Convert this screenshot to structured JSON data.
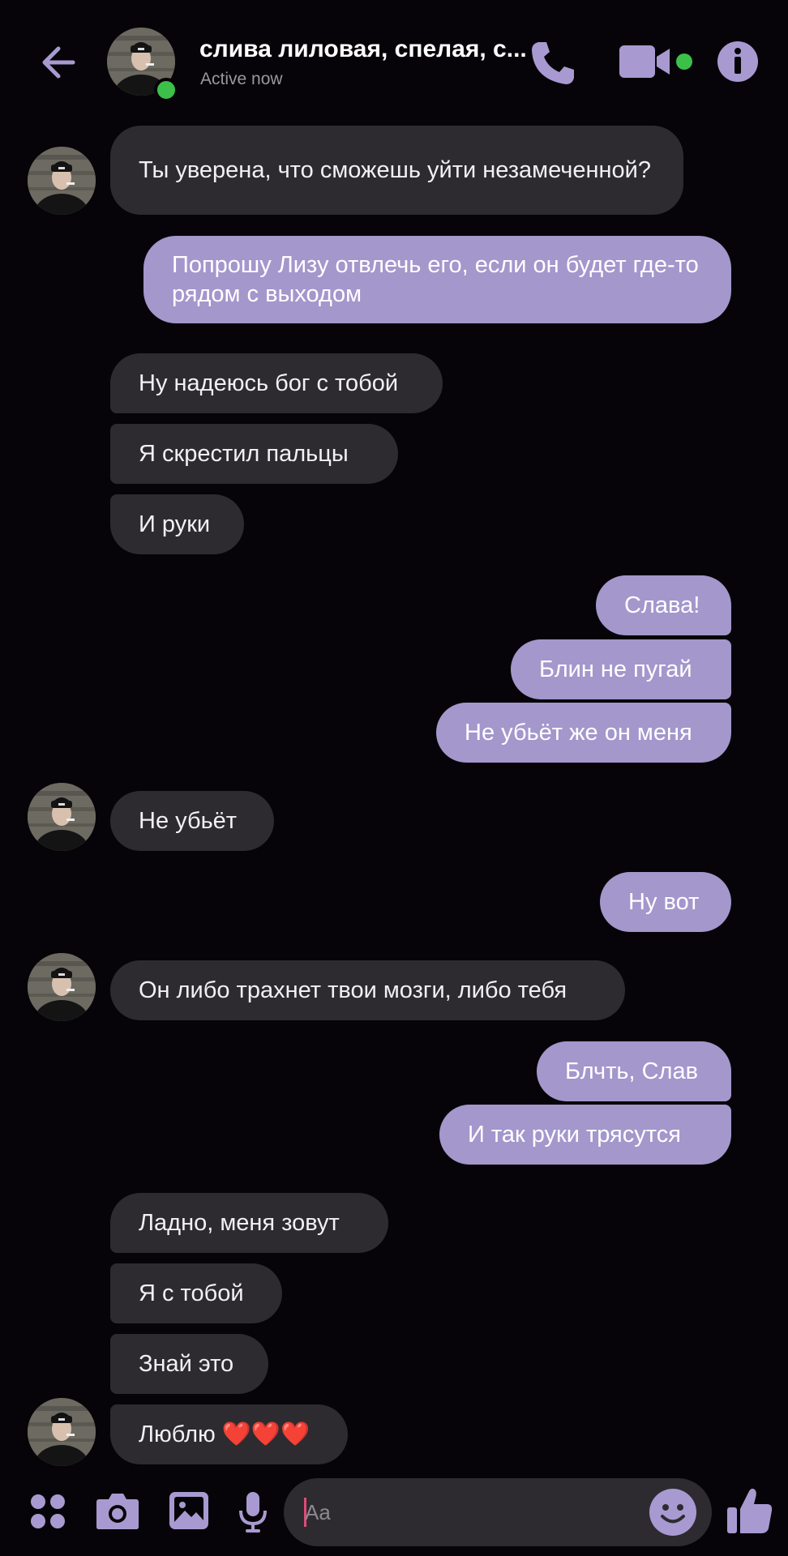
{
  "header": {
    "contact_name": "слива лиловая, спелая, с...",
    "status": "Active now",
    "icons": [
      "back-arrow-icon",
      "phone-icon",
      "video-camera-icon",
      "info-icon"
    ],
    "accent_color": "#a89ad0",
    "online_color": "#3cc04a"
  },
  "messages": [
    {
      "from": "contact",
      "text": "Ты уверена, что сможешь уйти незамеченной?"
    },
    {
      "from": "me",
      "text": "Попрошу Лизу отвлечь его, если он будет где-то рядом с выходом"
    },
    {
      "from": "contact",
      "text": "Ну надеюсь бог с тобой"
    },
    {
      "from": "contact",
      "text": "Я скрестил пальцы"
    },
    {
      "from": "contact",
      "text": "И руки"
    },
    {
      "from": "me",
      "text": "Слава!"
    },
    {
      "from": "me",
      "text": "Блин не пугай"
    },
    {
      "from": "me",
      "text": "Не убьёт же он меня"
    },
    {
      "from": "contact",
      "text": "Не убьёт"
    },
    {
      "from": "me",
      "text": "Ну вот"
    },
    {
      "from": "contact",
      "text": "Он либо трахнет твои мозги, либо тебя"
    },
    {
      "from": "me",
      "text": "Блчть, Слав"
    },
    {
      "from": "me",
      "text": "И так руки трясутся"
    },
    {
      "from": "contact",
      "text": "Ладно, меня зовут"
    },
    {
      "from": "contact",
      "text": "Я с тобой"
    },
    {
      "from": "contact",
      "text": "Знай это"
    },
    {
      "from": "contact",
      "text": "Люблю ❤️❤️❤️"
    }
  ],
  "composer": {
    "placeholder": "Aa",
    "icons": [
      "apps-grid-icon",
      "camera-icon",
      "gallery-icon",
      "microphone-icon",
      "emoji-icon",
      "thumbs-up-icon"
    ]
  },
  "colors": {
    "background": "#060408",
    "incoming_bubble": "#2d2b30",
    "outgoing_bubble": "#a397cc"
  }
}
